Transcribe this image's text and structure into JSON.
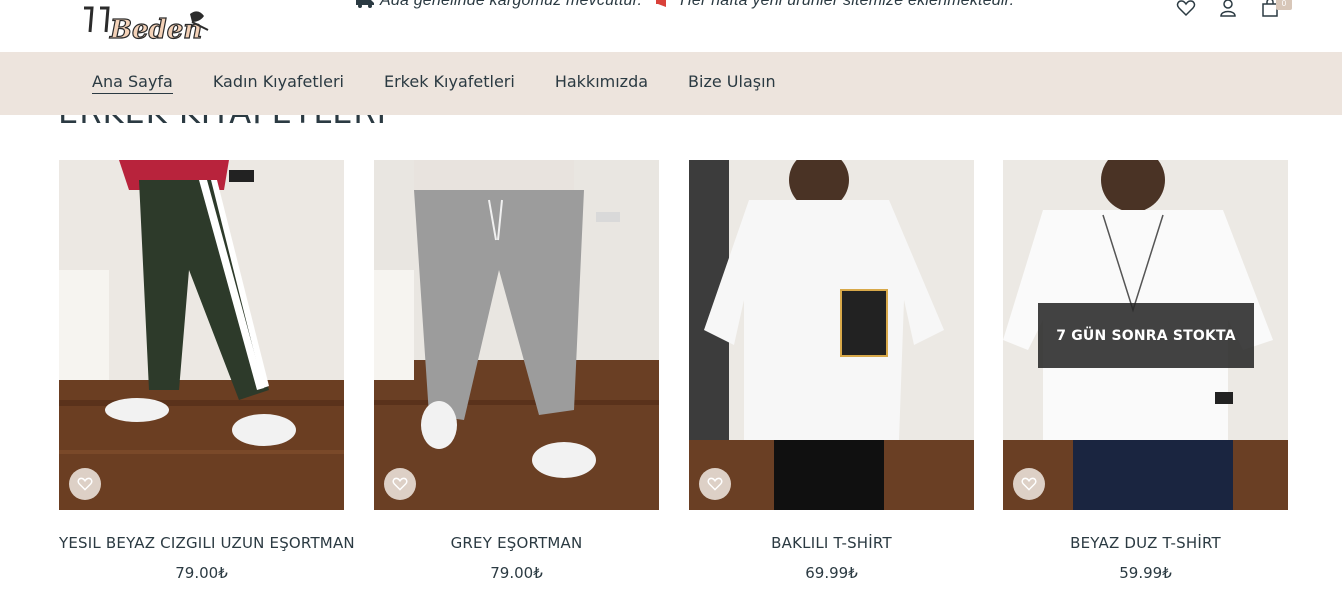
{
  "brand": {
    "logo_text": "Beden"
  },
  "announcement": {
    "msg1": "Ada genelinde kargomuz mevcuttur.",
    "msg2": "Her hafta yeni ürünler sitemize eklenmektedir."
  },
  "header_icons": {
    "wishlist": "heart-icon",
    "account": "user-icon",
    "cart": "shopping-bag-icon",
    "cart_count": "0"
  },
  "nav": {
    "items": [
      {
        "label": "Ana Sayfa",
        "active": true
      },
      {
        "label": "Kadın Kıyafetleri"
      },
      {
        "label": "Erkek Kıyafetleri"
      },
      {
        "label": "Hakkımızda"
      },
      {
        "label": "Bize Ulaşın"
      }
    ]
  },
  "section": {
    "title": "ERKEK KIYAFETLERİ"
  },
  "products": [
    {
      "name": "YESIL BEYAZ CIZGILI UZUN EŞORTMAN",
      "price": "79.00₺",
      "badge": ""
    },
    {
      "name": "GREY EŞORTMAN",
      "price": "79.00₺",
      "badge": ""
    },
    {
      "name": "BAKLILI T-SHİRT",
      "price": "69.99₺",
      "badge": ""
    },
    {
      "name": "BEYAZ DUZ T-SHİRT",
      "price": "59.99₺",
      "badge": "7 GÜN SONRA STOKTA"
    }
  ],
  "colors": {
    "nav_bg": "#ede4dd",
    "text": "#2b3a42",
    "accent": "#d8c7b9"
  }
}
